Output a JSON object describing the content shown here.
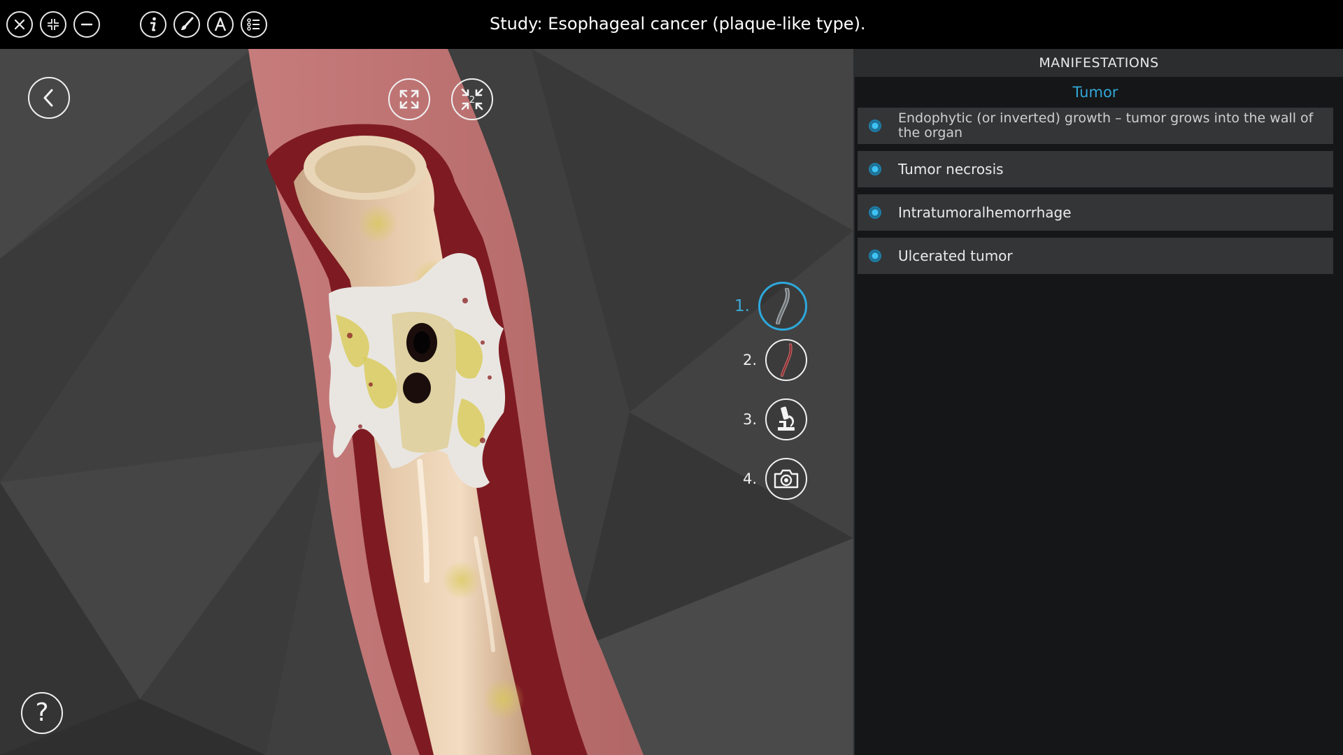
{
  "app": {
    "title": "Study: Esophageal cancer (plaque-like type)."
  },
  "toolbar": {
    "left_icons": [
      "close-icon",
      "restore-icon",
      "minimize-icon"
    ],
    "right_icons": [
      "info-icon",
      "brush-icon",
      "text-label-icon",
      "list-icon"
    ]
  },
  "viewport": {
    "back_icon": "chevron-left-icon",
    "help_label": "?",
    "expand_icon": "expand-arrows-icon",
    "compress_icon": "compress-arrows-icon",
    "compress_badge": "2",
    "steps": [
      {
        "number": "1.",
        "icon": "esophagus-gray-icon",
        "active": true
      },
      {
        "number": "2.",
        "icon": "esophagus-red-icon",
        "active": false
      },
      {
        "number": "3.",
        "icon": "microscope-icon",
        "active": false
      },
      {
        "number": "4.",
        "icon": "camera-icon",
        "active": false
      }
    ]
  },
  "panel": {
    "header": "MANIFESTATIONS",
    "subtitle": "Tumor",
    "items": [
      {
        "label": "Endophytic (or inverted) growth – tumor grows into the wall of the organ"
      },
      {
        "label": "Tumor necrosis"
      },
      {
        "label": "Intratumoralhemorrhage"
      },
      {
        "label": "Ulcerated tumor"
      }
    ]
  },
  "colors": {
    "accent": "#2ea8dc",
    "panel_bg": "#151617",
    "item_bg": "#343537",
    "viewport_bg": "#3f3f3f"
  }
}
